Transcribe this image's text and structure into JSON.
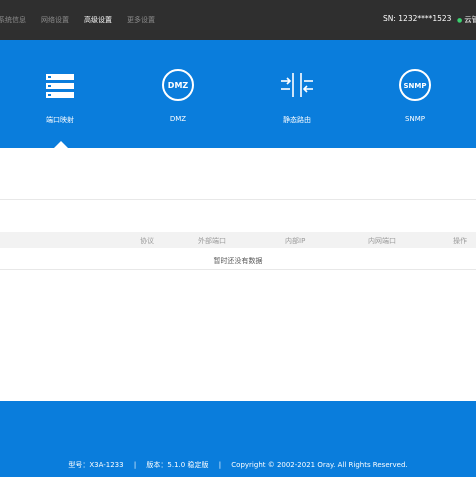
{
  "nav": {
    "items": [
      "系统信息",
      "网络设置",
      "高级设置",
      "更多设置"
    ],
    "active": "高级设置"
  },
  "device": {
    "sn_text": "SN:  1232****1523",
    "cloud_text": "云管"
  },
  "features": [
    {
      "label": "端口映射",
      "icon": "server-icon"
    },
    {
      "label": "DMZ",
      "icon": "dmz-icon",
      "icon_text": "DMZ"
    },
    {
      "label": "静态路由",
      "icon": "route-arrows-icon"
    },
    {
      "label": "SNMP",
      "icon": "snmp-icon",
      "icon_text": "SNMP"
    }
  ],
  "table": {
    "columns": [
      "协议",
      "外部端口",
      "内部IP",
      "内网端口",
      "操作"
    ],
    "empty_text": "暂时还没有数据"
  },
  "footer": {
    "model": "型号：X3A-1233",
    "version": "版本：5.1.0 稳定版",
    "copyright": "Copyright © 2002-2021 Oray. All Rights Reserved.",
    "separator": "|"
  },
  "colors": {
    "topbar": "#2f2f2f",
    "brand_blue": "#0a7ddc",
    "status_green": "#3bd16f"
  }
}
